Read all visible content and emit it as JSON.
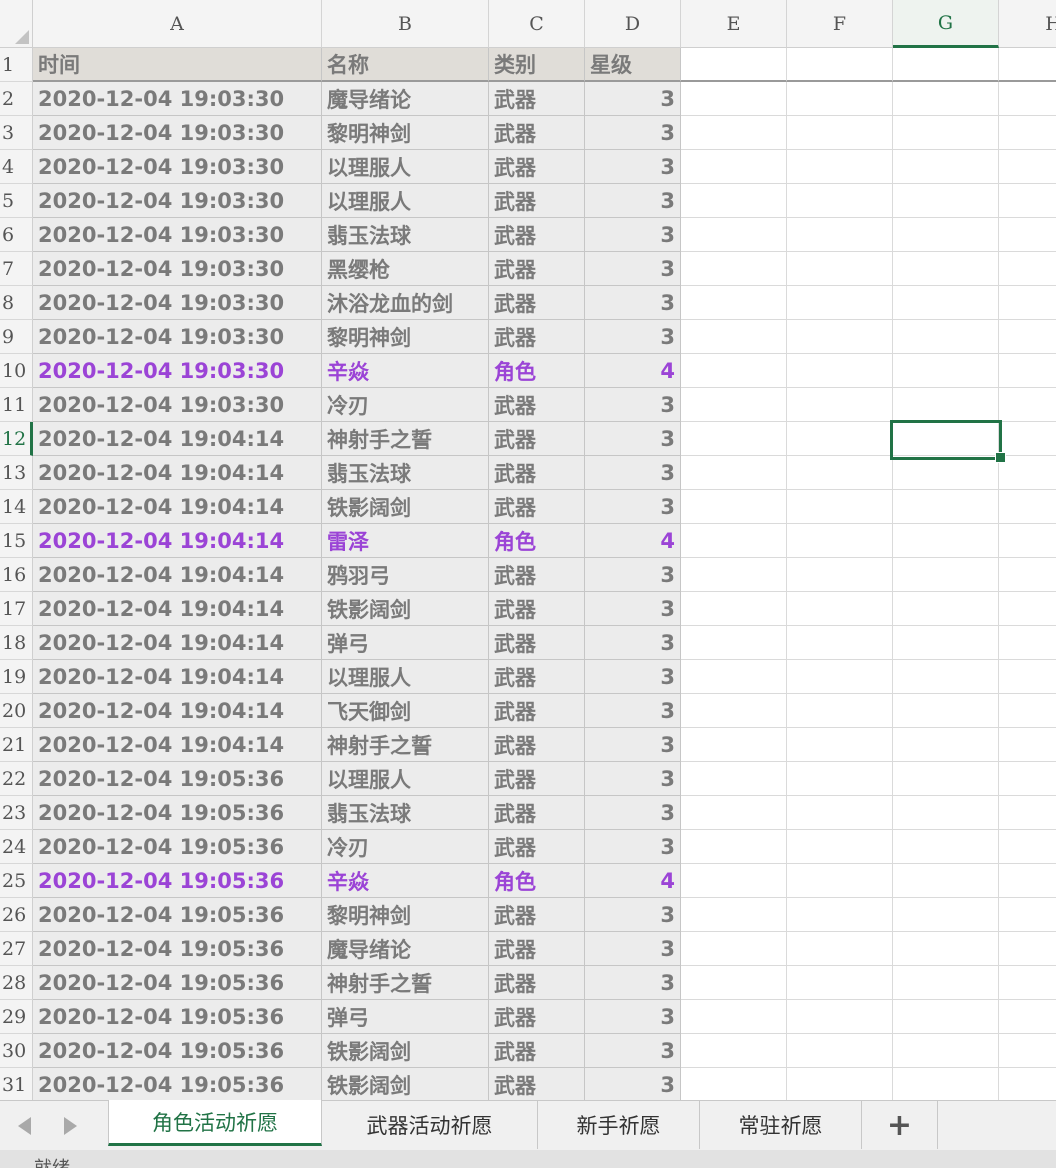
{
  "columns": [
    "A",
    "B",
    "C",
    "D",
    "E",
    "F",
    "G",
    "H"
  ],
  "selected_column": "G",
  "selected_row": "12",
  "header_row": {
    "row": "1",
    "cells": [
      "时间",
      "名称",
      "类别",
      "星级"
    ]
  },
  "rows": [
    {
      "row": "2",
      "time": "2020-12-04 19:03:30",
      "name": "魔导绪论",
      "type": "武器",
      "star": "3",
      "highlight": false
    },
    {
      "row": "3",
      "time": "2020-12-04 19:03:30",
      "name": "黎明神剑",
      "type": "武器",
      "star": "3",
      "highlight": false
    },
    {
      "row": "4",
      "time": "2020-12-04 19:03:30",
      "name": "以理服人",
      "type": "武器",
      "star": "3",
      "highlight": false
    },
    {
      "row": "5",
      "time": "2020-12-04 19:03:30",
      "name": "以理服人",
      "type": "武器",
      "star": "3",
      "highlight": false
    },
    {
      "row": "6",
      "time": "2020-12-04 19:03:30",
      "name": "翡玉法球",
      "type": "武器",
      "star": "3",
      "highlight": false
    },
    {
      "row": "7",
      "time": "2020-12-04 19:03:30",
      "name": "黑缨枪",
      "type": "武器",
      "star": "3",
      "highlight": false
    },
    {
      "row": "8",
      "time": "2020-12-04 19:03:30",
      "name": "沐浴龙血的剑",
      "type": "武器",
      "star": "3",
      "highlight": false
    },
    {
      "row": "9",
      "time": "2020-12-04 19:03:30",
      "name": "黎明神剑",
      "type": "武器",
      "star": "3",
      "highlight": false
    },
    {
      "row": "10",
      "time": "2020-12-04 19:03:30",
      "name": "辛焱",
      "type": "角色",
      "star": "4",
      "highlight": true
    },
    {
      "row": "11",
      "time": "2020-12-04 19:03:30",
      "name": "冷刃",
      "type": "武器",
      "star": "3",
      "highlight": false
    },
    {
      "row": "12",
      "time": "2020-12-04 19:04:14",
      "name": "神射手之誓",
      "type": "武器",
      "star": "3",
      "highlight": false
    },
    {
      "row": "13",
      "time": "2020-12-04 19:04:14",
      "name": "翡玉法球",
      "type": "武器",
      "star": "3",
      "highlight": false
    },
    {
      "row": "14",
      "time": "2020-12-04 19:04:14",
      "name": "铁影阔剑",
      "type": "武器",
      "star": "3",
      "highlight": false
    },
    {
      "row": "15",
      "time": "2020-12-04 19:04:14",
      "name": "雷泽",
      "type": "角色",
      "star": "4",
      "highlight": true
    },
    {
      "row": "16",
      "time": "2020-12-04 19:04:14",
      "name": "鸦羽弓",
      "type": "武器",
      "star": "3",
      "highlight": false
    },
    {
      "row": "17",
      "time": "2020-12-04 19:04:14",
      "name": "铁影阔剑",
      "type": "武器",
      "star": "3",
      "highlight": false
    },
    {
      "row": "18",
      "time": "2020-12-04 19:04:14",
      "name": "弹弓",
      "type": "武器",
      "star": "3",
      "highlight": false
    },
    {
      "row": "19",
      "time": "2020-12-04 19:04:14",
      "name": "以理服人",
      "type": "武器",
      "star": "3",
      "highlight": false
    },
    {
      "row": "20",
      "time": "2020-12-04 19:04:14",
      "name": "飞天御剑",
      "type": "武器",
      "star": "3",
      "highlight": false
    },
    {
      "row": "21",
      "time": "2020-12-04 19:04:14",
      "name": "神射手之誓",
      "type": "武器",
      "star": "3",
      "highlight": false
    },
    {
      "row": "22",
      "time": "2020-12-04 19:05:36",
      "name": "以理服人",
      "type": "武器",
      "star": "3",
      "highlight": false
    },
    {
      "row": "23",
      "time": "2020-12-04 19:05:36",
      "name": "翡玉法球",
      "type": "武器",
      "star": "3",
      "highlight": false
    },
    {
      "row": "24",
      "time": "2020-12-04 19:05:36",
      "name": "冷刃",
      "type": "武器",
      "star": "3",
      "highlight": false
    },
    {
      "row": "25",
      "time": "2020-12-04 19:05:36",
      "name": "辛焱",
      "type": "角色",
      "star": "4",
      "highlight": true
    },
    {
      "row": "26",
      "time": "2020-12-04 19:05:36",
      "name": "黎明神剑",
      "type": "武器",
      "star": "3",
      "highlight": false
    },
    {
      "row": "27",
      "time": "2020-12-04 19:05:36",
      "name": "魔导绪论",
      "type": "武器",
      "star": "3",
      "highlight": false
    },
    {
      "row": "28",
      "time": "2020-12-04 19:05:36",
      "name": "神射手之誓",
      "type": "武器",
      "star": "3",
      "highlight": false
    },
    {
      "row": "29",
      "time": "2020-12-04 19:05:36",
      "name": "弹弓",
      "type": "武器",
      "star": "3",
      "highlight": false
    },
    {
      "row": "30",
      "time": "2020-12-04 19:05:36",
      "name": "铁影阔剑",
      "type": "武器",
      "star": "3",
      "highlight": false
    },
    {
      "row": "31",
      "time": "2020-12-04 19:05:36",
      "name": "铁影阔剑",
      "type": "武器",
      "star": "3",
      "highlight": false
    }
  ],
  "sheet_tabs": [
    {
      "label": "角色活动祈愿",
      "active": true
    },
    {
      "label": "武器活动祈愿",
      "active": false
    },
    {
      "label": "新手祈愿",
      "active": false
    },
    {
      "label": "常驻祈愿",
      "active": false
    }
  ],
  "add_tab_label": "+",
  "status_text": "就绪",
  "colors": {
    "accent": "#217346",
    "highlight_text": "#9b44d6",
    "normal_text": "#7a7a7a",
    "data_fill": "#ececec",
    "header_fill": "#e0ddd8"
  }
}
